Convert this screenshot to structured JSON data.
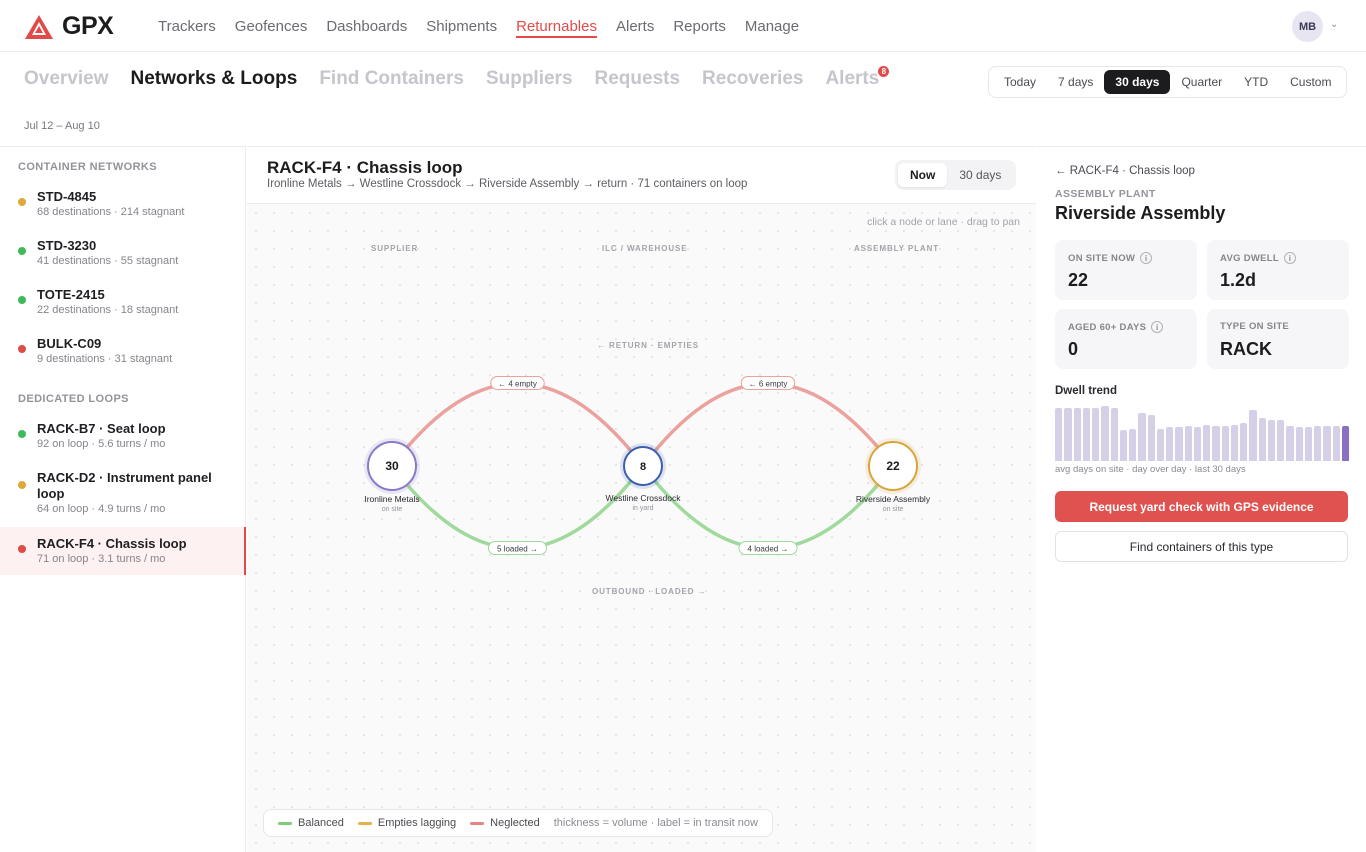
{
  "brand": {
    "name": "GPX",
    "accent": "#e24a4a"
  },
  "topnav": {
    "items": [
      "Trackers",
      "Geofences",
      "Dashboards",
      "Shipments",
      "Returnables",
      "Alerts",
      "Reports",
      "Manage"
    ],
    "active": "Returnables",
    "avatar_initials": "MB"
  },
  "subtabs": {
    "items": [
      {
        "label": "Overview"
      },
      {
        "label": "Networks & Loops",
        "active": true
      },
      {
        "label": "Find Containers"
      },
      {
        "label": "Suppliers"
      },
      {
        "label": "Requests"
      },
      {
        "label": "Recoveries"
      },
      {
        "label": "Alerts",
        "badge": "8"
      }
    ]
  },
  "range": {
    "options": [
      "Today",
      "7 days",
      "30 days",
      "Quarter",
      "YTD",
      "Custom"
    ],
    "selected": "30 days",
    "caption": "Jul 12 – Aug 10"
  },
  "sidebar": {
    "networks_label": "CONTAINER NETWORKS",
    "networks": [
      {
        "title": "STD-4845",
        "sub": "68 destinations · 214 stagnant",
        "status": "amber"
      },
      {
        "title": "STD-3230",
        "sub": "41 destinations · 55 stagnant",
        "status": "green"
      },
      {
        "title": "TOTE-2415",
        "sub": "22 destinations · 18 stagnant",
        "status": "green"
      },
      {
        "title": "BULK-C09",
        "sub": "9 destinations · 31 stagnant",
        "status": "red"
      }
    ],
    "loops_label": "DEDICATED LOOPS",
    "loops": [
      {
        "title": "RACK-B7 · Seat loop",
        "sub": "92 on loop · 5.6 turns / mo",
        "status": "green"
      },
      {
        "title": "RACK-D2 · Instrument panel loop",
        "sub": "64 on loop · 4.9 turns / mo",
        "status": "amber"
      },
      {
        "title": "RACK-F4 · Chassis loop",
        "sub": "71 on loop · 3.1 turns / mo",
        "status": "red",
        "active": true
      }
    ]
  },
  "status_colors": {
    "green": "#3fba5a",
    "amber": "#e0a73b",
    "red": "#dd4c46"
  },
  "loop": {
    "title": "RACK-F4 · Chassis loop",
    "path": "Ironline Metals → Westline Crossdock → Riverside Assembly → return · 71 containers on loop",
    "time_options": [
      "Now",
      "30 days"
    ],
    "time_selected": "Now",
    "hint": "click a node or lane · drag to pan",
    "columns": [
      "SUPPLIER",
      "ILC / WAREHOUSE",
      "ASSEMBLY PLANT"
    ],
    "return_caption": "← RETURN · EMPTIES",
    "outbound_caption": "OUTBOUND · LOADED →",
    "nodes": [
      {
        "id": "ironline",
        "name": "Ironline Metals",
        "sub": "on site",
        "count": "30",
        "ring": "#8a78c8"
      },
      {
        "id": "westline",
        "name": "Westline Crossdock",
        "sub": "in yard",
        "count": "8",
        "ring": "#3b5fae"
      },
      {
        "id": "riverside",
        "name": "Riverside Assembly",
        "sub": "on site",
        "count": "22",
        "ring": "#d9a43a"
      }
    ],
    "lanes": [
      {
        "from": "westline",
        "to": "ironline",
        "dir": "return",
        "label": "← 4 empty",
        "status": "red"
      },
      {
        "from": "riverside",
        "to": "westline",
        "dir": "return",
        "label": "← 6 empty",
        "status": "red"
      },
      {
        "from": "ironline",
        "to": "westline",
        "dir": "outbound",
        "label": "5 loaded →",
        "status": "green"
      },
      {
        "from": "westline",
        "to": "riverside",
        "dir": "outbound",
        "label": "4 loaded →",
        "status": "green"
      }
    ],
    "lane_colors": {
      "green": "#9fd99b",
      "red": "#eba19c"
    },
    "legend": [
      {
        "label": "Balanced",
        "color": "#7ccf78"
      },
      {
        "label": "Empties lagging",
        "color": "#e6b14a"
      },
      {
        "label": "Neglected",
        "color": "#e6847e"
      }
    ],
    "legend_note": "thickness = volume · label = in transit now"
  },
  "detail": {
    "back": "← RACK-F4 · Chassis loop",
    "kicker": "ASSEMBLY PLANT",
    "title": "Riverside Assembly",
    "stats": [
      {
        "label": "ON SITE NOW",
        "value": "22",
        "info": true
      },
      {
        "label": "AVG DWELL",
        "value": "1.2d",
        "info": true
      },
      {
        "label": "AGED 60+ DAYS",
        "value": "0",
        "info": true
      },
      {
        "label": "TYPE ON SITE",
        "value": "RACK",
        "info": false
      }
    ],
    "trend_label": "Dwell trend",
    "trend_values": [
      0.92,
      0.92,
      0.92,
      0.92,
      0.92,
      0.94,
      0.92,
      0.53,
      0.55,
      0.83,
      0.8,
      0.55,
      0.58,
      0.58,
      0.6,
      0.58,
      0.62,
      0.6,
      0.6,
      0.62,
      0.65,
      0.88,
      0.75,
      0.7,
      0.7,
      0.6,
      0.58,
      0.58,
      0.6,
      0.6,
      0.6,
      0.6
    ],
    "trend_caption": "avg days on site · day over day · last 30 days",
    "primary_action": "Request yard check with GPS evidence",
    "secondary_action": "Find containers of this type"
  }
}
